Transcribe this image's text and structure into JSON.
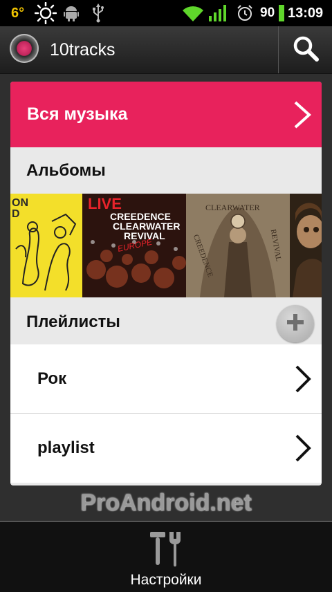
{
  "status_bar": {
    "temperature": "6°",
    "battery": "90",
    "time": "13:09",
    "icons": [
      "sun-icon",
      "android-icon",
      "usb-icon",
      "wifi-icon",
      "signal-icon",
      "alarm-icon",
      "battery-icon"
    ]
  },
  "action_bar": {
    "title": "10tracks",
    "logo_icon": "app-logo-icon",
    "search_icon": "search-icon"
  },
  "main": {
    "all_music_label": "Вся музыка",
    "albums_label": "Альбомы",
    "album_cover_texts": [
      {
        "lines": [
          "ON",
          "D"
        ]
      },
      {
        "lines": [
          "LIVE",
          "CREEDENCE",
          "CLEARWATER",
          "REVIVAL",
          "EUROPE"
        ]
      },
      {
        "lines": [
          "CLEARWATER",
          "CREEDENCE",
          "REVIVAL"
        ]
      },
      {
        "lines": []
      }
    ],
    "playlists_label": "Плейлисты",
    "playlists": [
      {
        "label": "Рок"
      },
      {
        "label": "playlist"
      }
    ]
  },
  "watermark": "ProAndroid.net",
  "bottom_bar": {
    "settings_label": "Настройки"
  },
  "colors": {
    "accent": "#e8225c",
    "status_temp": "#f2c500",
    "wifi": "#5fd62b"
  }
}
